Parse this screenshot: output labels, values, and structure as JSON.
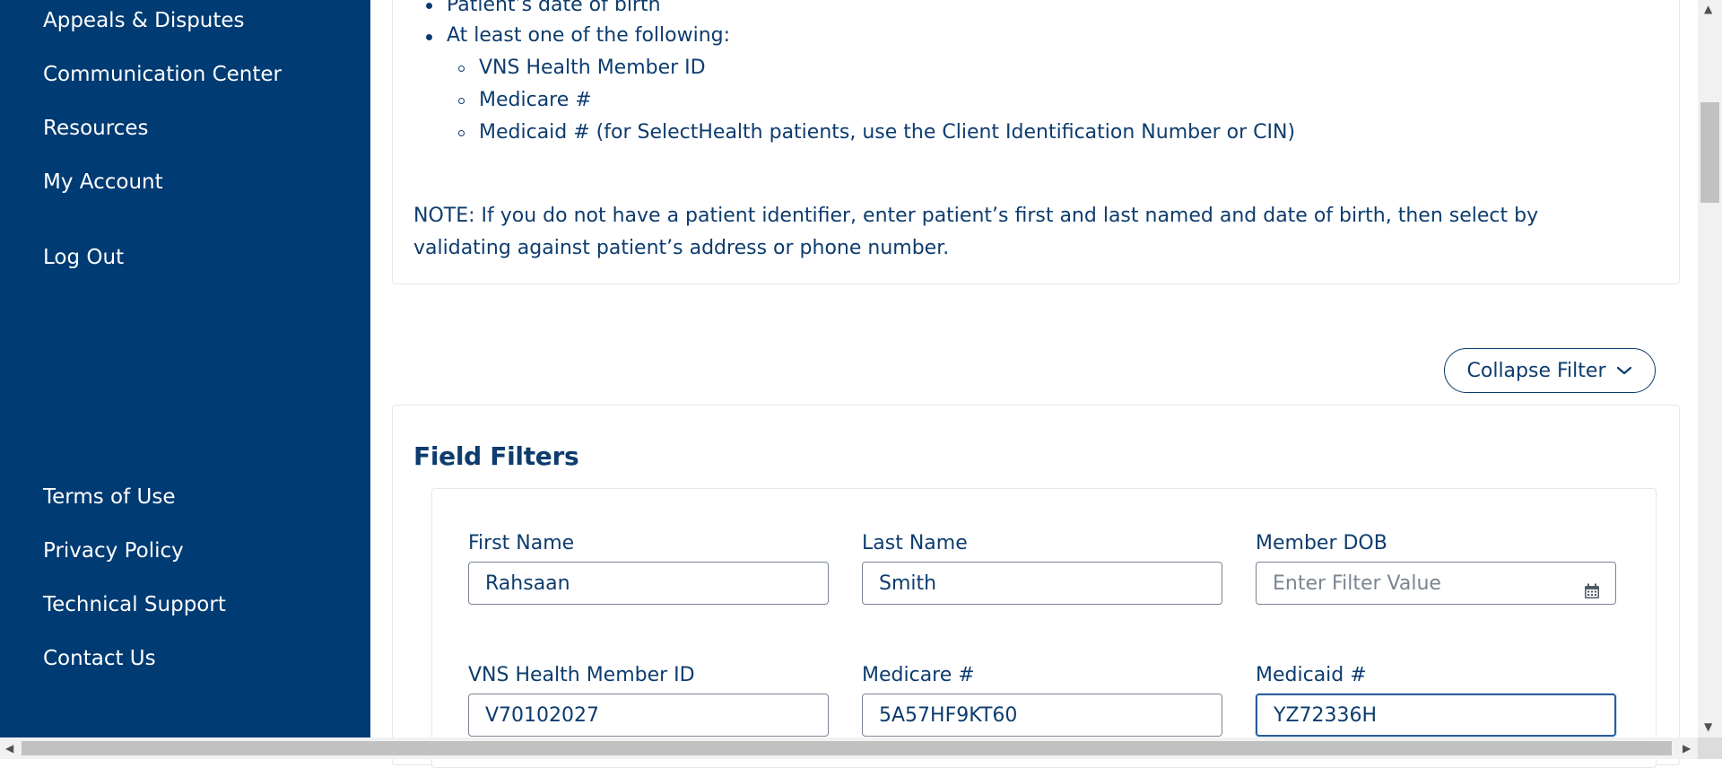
{
  "sidebar": {
    "nav": [
      "Appeals & Disputes",
      "Communication Center",
      "Resources",
      "My Account"
    ],
    "logout": "Log Out",
    "footer_links": [
      "Terms of Use",
      "Privacy Policy",
      "Technical Support",
      "Contact Us"
    ]
  },
  "instructions": {
    "bullets": [
      "Patient’s date of birth",
      "At least one of the following:"
    ],
    "sub_bullets": [
      "VNS Health Member ID",
      "Medicare #",
      "Medicaid # (for SelectHealth patients, use the Client Identification Number or CIN)"
    ],
    "note": "NOTE: If you do not have a patient identifier, enter patient’s first and last named and date of birth, then select by validating against patient’s address or phone number."
  },
  "filter_toggle": {
    "label": "Collapse Filter",
    "icon": "chevron-down-icon"
  },
  "field_filters": {
    "title": "Field Filters",
    "fields": [
      {
        "label": "First Name",
        "value": "Rahsaan",
        "placeholder": ""
      },
      {
        "label": "Last Name",
        "value": "Smith",
        "placeholder": ""
      },
      {
        "label": "Member DOB",
        "value": "",
        "placeholder": "Enter Filter Value",
        "icon": "calendar-icon"
      },
      {
        "label": "VNS Health Member ID",
        "value": "V70102027",
        "placeholder": ""
      },
      {
        "label": "Medicare #",
        "value": "5A57HF9KT60",
        "placeholder": ""
      },
      {
        "label": "Medicaid #",
        "value": "YZ72336H",
        "placeholder": ""
      }
    ]
  },
  "colors": {
    "sidebar_bg": "#003b73",
    "text_primary": "#0d3c6e",
    "border": "#7a8594"
  }
}
